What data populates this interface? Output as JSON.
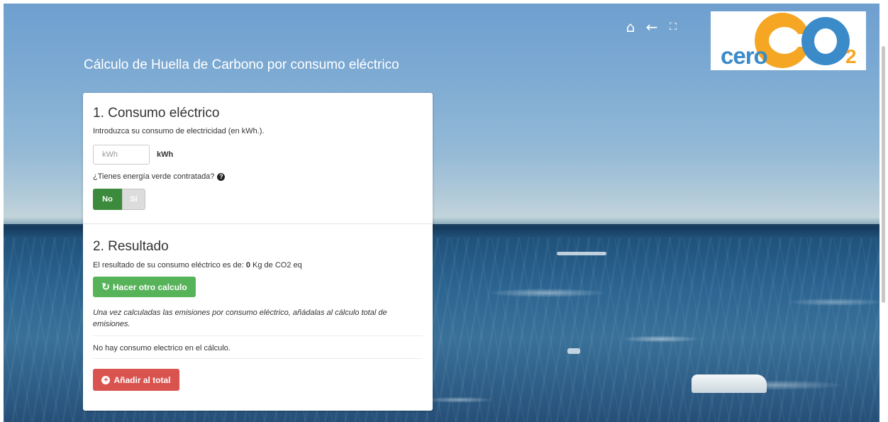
{
  "header": {
    "title": "Cálculo de Huella de Carbono por consumo eléctrico",
    "icons": [
      "home-icon",
      "back-arrow-icon",
      "fullscreen-icon"
    ]
  },
  "logo": {
    "prefix": "cero",
    "main": "CO",
    "subscript": "2"
  },
  "consumo": {
    "heading": "1. Consumo eléctrico",
    "help": "Introduzca su consumo de electricidad (en kWh.).",
    "placeholder": "kWh",
    "unit": "kWh",
    "question": "¿Tienes energía verde contratada?",
    "toggle_no": "No",
    "toggle_si": "Sí"
  },
  "resultado": {
    "heading": "2. Resultado",
    "text_before": "El resultado de su consumo eléctrico es de: ",
    "value": "0",
    "text_after": " Kg de CO2 eq",
    "recalc_button": "Hacer otro calculo",
    "note": "Una vez calculadas las emisiones por consumo eléctrico, añádalas al cálculo total de emisiones.",
    "empty_message": "No hay consumo electrico en el cálculo.",
    "add_button": "Añadir al total"
  },
  "colors": {
    "green_toggle": "#3c8a3c",
    "green_button": "#57b35a",
    "red_button": "#d9534f",
    "logo_blue": "#3b8bc9",
    "logo_orange": "#f5a623"
  }
}
